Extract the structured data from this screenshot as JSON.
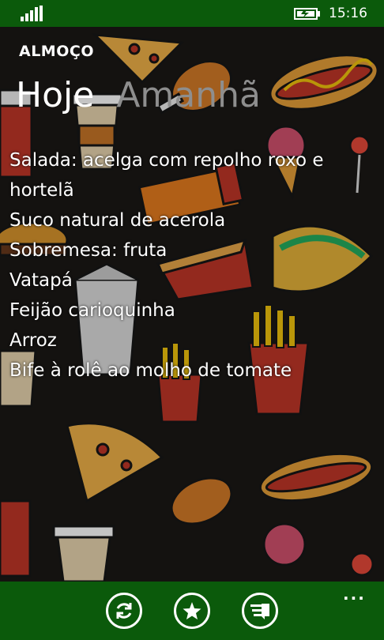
{
  "status": {
    "time": "15:16"
  },
  "app": {
    "title": "ALMOÇO"
  },
  "tabs": [
    {
      "label": "Hoje",
      "active": true
    },
    {
      "label": "Amanhã",
      "active": false
    }
  ],
  "menu": {
    "items": [
      "Salada: acelga com repolho roxo e hortelã",
      "Suco natural de acerola",
      "Sobremesa: fruta",
      "Vatapá",
      "Feijão carioquinha",
      "Arroz",
      "Bife à rolê ao molho de tomate"
    ]
  },
  "appbar": {
    "buttons": [
      {
        "icon": "refresh-icon"
      },
      {
        "icon": "star-icon"
      },
      {
        "icon": "list-icon"
      }
    ],
    "more": "..."
  },
  "colors": {
    "accent": "#0b5a0b",
    "background": "#141210",
    "inactive_tab": "#8e8e8e"
  }
}
